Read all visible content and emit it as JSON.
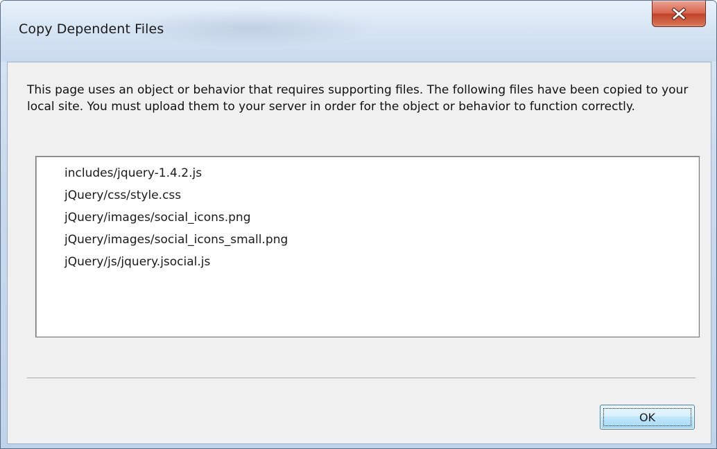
{
  "window": {
    "title": "Copy Dependent Files"
  },
  "icons": {
    "close": "close-icon"
  },
  "colors": {
    "close_button": "#c9503a",
    "ok_button_border": "#3c7fb1",
    "window_frame": "#c9daee"
  },
  "dialog": {
    "message": "This page uses an object or behavior that requires supporting files. The following files have been copied to your local site. You must upload them to your server in order for the object or behavior to function correctly.",
    "files": [
      "includes/jquery-1.4.2.js",
      "jQuery/css/style.css",
      "jQuery/images/social_icons.png",
      "jQuery/images/social_icons_small.png",
      "jQuery/js/jquery.jsocial.js"
    ],
    "ok_label": "OK"
  }
}
